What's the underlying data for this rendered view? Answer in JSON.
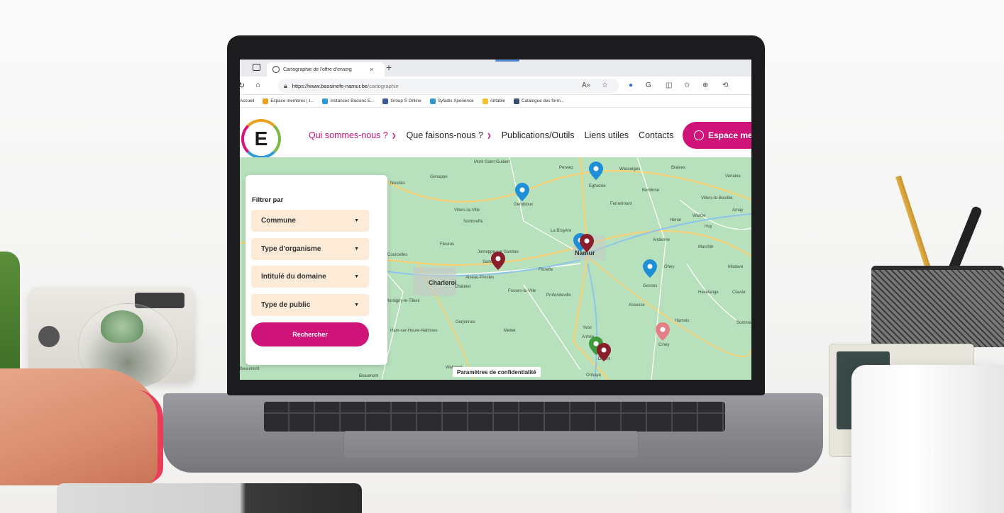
{
  "browser": {
    "tab_title": "Cartographie de l'offre d'enseig",
    "tab_close": "×",
    "new_tab": "+",
    "url_host": "https://www.bassinefe-namur.be",
    "url_path": "/cartographie",
    "bookmarks": [
      {
        "label": "Accueil",
        "color": "#d6147e"
      },
      {
        "label": "Espace membres | I...",
        "color": "#e8a21d"
      },
      {
        "label": "Instances Bassins E...",
        "color": "#2e9ad6"
      },
      {
        "label": "Group S Online",
        "color": "#3b5998"
      },
      {
        "label": "Syfadis Xperience",
        "color": "#2e9ad6"
      },
      {
        "label": "Airtable",
        "color": "#f2c230"
      },
      {
        "label": "Catalogue des form...",
        "color": "#3d4e6a"
      }
    ]
  },
  "site": {
    "logo_letter": "E",
    "menu": [
      {
        "label": "Qui sommes-nous ?",
        "has_chevron": true,
        "active": true
      },
      {
        "label": "Que faisons-nous ?",
        "has_chevron": true,
        "active": false
      },
      {
        "label": "Publications/Outils",
        "has_chevron": false,
        "active": false
      },
      {
        "label": "Liens utiles",
        "has_chevron": false,
        "active": false
      },
      {
        "label": "Contacts",
        "has_chevron": false,
        "active": false
      }
    ],
    "espace_button": "Espace mem",
    "accent_color": "#cf1479"
  },
  "filter": {
    "title": "Filtrer par",
    "selects": [
      "Commune",
      "Type d'organisme",
      "Intitulé du domaine",
      "Type de public"
    ],
    "search_button": "Rechercher"
  },
  "map": {
    "privacy_label": "Paramètres de confidentialité",
    "labels": [
      {
        "text": "Mont-Saint-Guibert",
        "city": false
      },
      {
        "text": "Genappe",
        "city": false
      },
      {
        "text": "Nivelles",
        "city": false
      },
      {
        "text": "Perwez",
        "city": false
      },
      {
        "text": "Wasseiges",
        "city": false
      },
      {
        "text": "Braives",
        "city": false
      },
      {
        "text": "Eghezée",
        "city": false
      },
      {
        "text": "Gembloux",
        "city": false
      },
      {
        "text": "Burdinne",
        "city": false
      },
      {
        "text": "Villers-le-Bouillet",
        "city": false
      },
      {
        "text": "Verlaine",
        "city": false
      },
      {
        "text": "Villers-la-Ville",
        "city": false
      },
      {
        "text": "Fernelmont",
        "city": false
      },
      {
        "text": "Sombreffe",
        "city": false
      },
      {
        "text": "Wanze",
        "city": false
      },
      {
        "text": "Amay",
        "city": false
      },
      {
        "text": "Héron",
        "city": false
      },
      {
        "text": "Huy",
        "city": false
      },
      {
        "text": "La Bruyère",
        "city": false
      },
      {
        "text": "Fleurus",
        "city": false
      },
      {
        "text": "Andenne",
        "city": false
      },
      {
        "text": "Marchin",
        "city": false
      },
      {
        "text": "Namur",
        "city": true
      },
      {
        "text": "Courcelles",
        "city": false
      },
      {
        "text": "Jemeppe-sur-Sambre",
        "city": false
      },
      {
        "text": "Sambreville",
        "city": false
      },
      {
        "text": "Floreffe",
        "city": false
      },
      {
        "text": "Ohey",
        "city": false
      },
      {
        "text": "Modave",
        "city": false
      },
      {
        "text": "Charleroi",
        "city": true
      },
      {
        "text": "Aiseau-Presles",
        "city": false
      },
      {
        "text": "Châtelet",
        "city": false
      },
      {
        "text": "Gesves",
        "city": false
      },
      {
        "text": "Fosses-la-Ville",
        "city": false
      },
      {
        "text": "Profondeville",
        "city": false
      },
      {
        "text": "Havelange",
        "city": false
      },
      {
        "text": "Clavier",
        "city": false
      },
      {
        "text": "Montigny-le-Tilleul",
        "city": false
      },
      {
        "text": "Assesse",
        "city": false
      },
      {
        "text": "Gerpinnes",
        "city": false
      },
      {
        "text": "Hamois",
        "city": false
      },
      {
        "text": "Somme",
        "city": false
      },
      {
        "text": "Ham-sur-Heure-Nalinnes",
        "city": false
      },
      {
        "text": "Mettet",
        "city": false
      },
      {
        "text": "Yvoir",
        "city": false
      },
      {
        "text": "Anhée",
        "city": false
      },
      {
        "text": "Ciney",
        "city": false
      },
      {
        "text": "Dinant",
        "city": false
      },
      {
        "text": "Walcourt",
        "city": false
      },
      {
        "text": "Beaumont",
        "city": false
      },
      {
        "text": "Onhaye",
        "city": false
      },
      {
        "text": "Beaumont",
        "city": false
      }
    ],
    "markers": [
      {
        "color": "#1e8fd6"
      },
      {
        "color": "#1e8fd6"
      },
      {
        "color": "#1e8fd6"
      },
      {
        "color": "#8b1e2b"
      },
      {
        "color": "#8b1e2b"
      },
      {
        "color": "#1e8fd6"
      },
      {
        "color": "#e37f85"
      },
      {
        "color": "#3f9a3c"
      },
      {
        "color": "#8b1e2b"
      }
    ]
  }
}
